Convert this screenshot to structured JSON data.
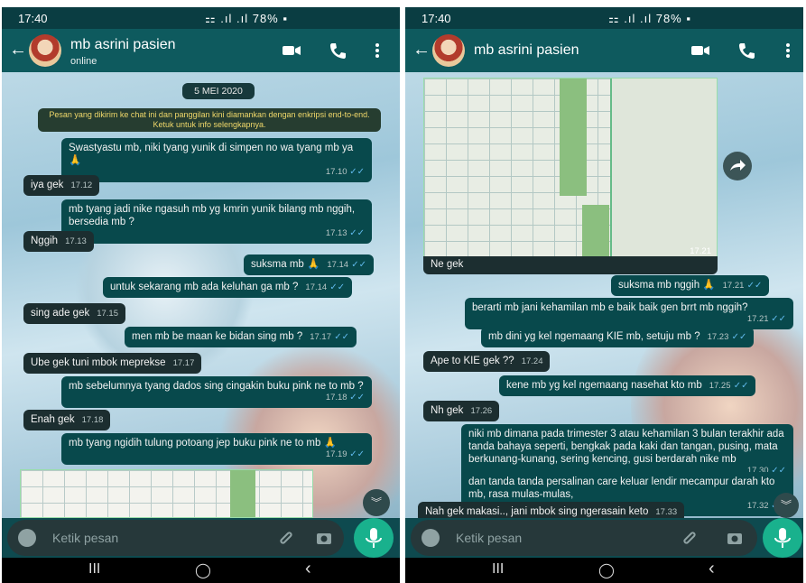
{
  "left": {
    "status": {
      "time": "17:40",
      "signal": "⚏ .ıl .ıl 78% ▪"
    },
    "header": {
      "name": "mb asrini pasien",
      "status": "online"
    },
    "date": "5 MEI 2020",
    "notice": "Pesan yang dikirim ke chat ini dan panggilan kini diamankan dengan enkripsi end-to-end. Ketuk untuk info selengkapnya.",
    "messages": [
      {
        "text": "Swastyastu mb, niki tyang yunik di simpen no wa tyang mb ya 🙏",
        "time": "17.10"
      },
      {
        "text": "iya gek",
        "time": "17.12"
      },
      {
        "text": "mb tyang jadi nike ngasuh mb yg kmrin yunik bilang mb nggih, bersedia mb ?",
        "time": "17.13"
      },
      {
        "text": "Nggih",
        "time": "17.13"
      },
      {
        "text": "suksma mb 🙏",
        "time": "17.14"
      },
      {
        "text": "untuk sekarang mb ada keluhan ga mb ?",
        "time": "17.14"
      },
      {
        "text": "sing ade gek",
        "time": "17.15"
      },
      {
        "text": "men mb be maan ke bidan sing mb ?",
        "time": "17.17"
      },
      {
        "text": "Ube gek tuni mbok meprekse",
        "time": "17.17"
      },
      {
        "text": "mb sebelumnya tyang dados sing cingakin buku pink ne to mb ?",
        "time": "17.18"
      },
      {
        "text": "Enah gek",
        "time": "17.18"
      },
      {
        "text": "mb tyang ngidih tulung potoang jep buku pink ne to mb 🙏",
        "time": "17.19"
      }
    ],
    "composer_placeholder": "Ketik pesan"
  },
  "right": {
    "status": {
      "time": "17:40",
      "signal": "⚏ .ıl .ıl 78% ▪"
    },
    "header": {
      "name": "mb asrini pasien"
    },
    "image_time": "17.21",
    "messages": [
      {
        "text": "Ne gek",
        "time": ""
      },
      {
        "text": "suksma mb nggih 🙏",
        "time": "17.21"
      },
      {
        "text": "berarti mb jani kehamilan mb e baik baik gen brrt mb nggih?",
        "time": "17.21"
      },
      {
        "text": "mb dini yg kel ngemaang KIE mb, setuju mb ?",
        "time": "17.23"
      },
      {
        "text": "Ape to KIE gek ??",
        "time": "17.24"
      },
      {
        "text": "kene mb yg kel ngemaang nasehat kto mb",
        "time": "17.25"
      },
      {
        "text": "Nh gek",
        "time": "17.26"
      },
      {
        "text": "niki mb dimana pada trimester 3 atau kehamilan 3 bulan terakhir ada tanda bahaya seperti, bengkak pada kaki dan tangan, pusing, mata berkunang-kunang, sering kencing, gusi berdarah nike mb",
        "time": "17.30"
      },
      {
        "text": "dan tanda tanda persalinan care keluar lendir mecampur darah kto mb, rasa mulas-mulas,",
        "time": "17.32"
      },
      {
        "text": "Nah gek makasi.., jani mbok sing ngerasain keto",
        "time": "17.33"
      }
    ],
    "composer_placeholder": "Ketik pesan"
  },
  "nav": {
    "recent": "III",
    "home": "◯",
    "back": "‹"
  },
  "colors": {
    "out_bubble": "#08494c",
    "in_bubble": "#1c2e30",
    "header": "#0e5a5e",
    "mic": "#19b18d",
    "read_tick": "#5fb8ea"
  }
}
